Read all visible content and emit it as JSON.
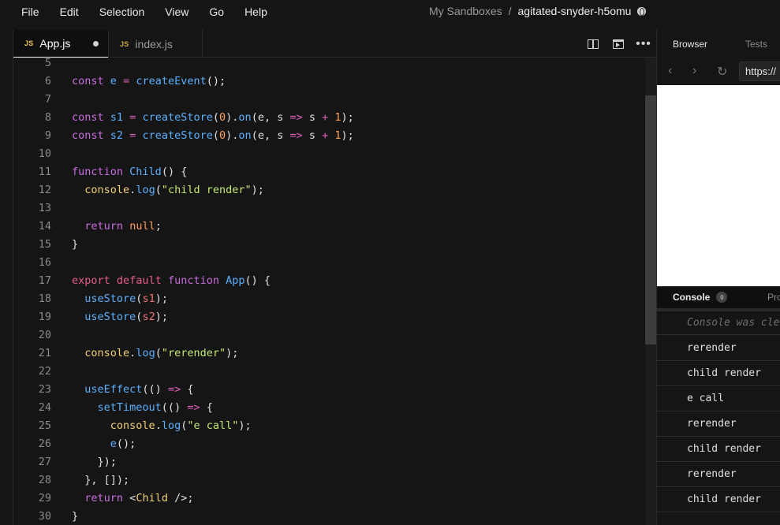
{
  "menubar": {
    "items": [
      "File",
      "Edit",
      "Selection",
      "View",
      "Go",
      "Help"
    ],
    "breadcrumb_parent": "My Sandboxes",
    "breadcrumb_separator": "/",
    "breadcrumb_current": "agitated-snyder-h5omu"
  },
  "editor": {
    "tabs": [
      {
        "badge": "JS",
        "label": "App.js",
        "active": true,
        "unsaved": true
      },
      {
        "badge": "JS",
        "label": "index.js",
        "active": false,
        "unsaved": false
      }
    ],
    "actions": [
      "split-view-icon",
      "open-preview-icon",
      "more-icon"
    ],
    "more_glyph": "•••",
    "lines": [
      {
        "n": "5",
        "tokens": []
      },
      {
        "n": "6",
        "tokens": [
          [
            "kw",
            "const"
          ],
          [
            "p",
            " "
          ],
          [
            "fn",
            "e"
          ],
          [
            "p",
            " "
          ],
          [
            "op",
            "="
          ],
          [
            "p",
            " "
          ],
          [
            "fn",
            "createEvent"
          ],
          [
            "p",
            "();"
          ]
        ]
      },
      {
        "n": "7",
        "tokens": []
      },
      {
        "n": "8",
        "tokens": [
          [
            "kw",
            "const"
          ],
          [
            "p",
            " "
          ],
          [
            "fn",
            "s1"
          ],
          [
            "p",
            " "
          ],
          [
            "op",
            "="
          ],
          [
            "p",
            " "
          ],
          [
            "fn",
            "createStore"
          ],
          [
            "p",
            "("
          ],
          [
            "num",
            "0"
          ],
          [
            "p",
            ")."
          ],
          [
            "fn",
            "on"
          ],
          [
            "p",
            "(e, s "
          ],
          [
            "op",
            "=>"
          ],
          [
            "p",
            " s "
          ],
          [
            "op",
            "+"
          ],
          [
            "p",
            " "
          ],
          [
            "num",
            "1"
          ],
          [
            "p",
            ");"
          ]
        ]
      },
      {
        "n": "9",
        "tokens": [
          [
            "kw",
            "const"
          ],
          [
            "p",
            " "
          ],
          [
            "fn",
            "s2"
          ],
          [
            "p",
            " "
          ],
          [
            "op",
            "="
          ],
          [
            "p",
            " "
          ],
          [
            "fn",
            "createStore"
          ],
          [
            "p",
            "("
          ],
          [
            "num",
            "0"
          ],
          [
            "p",
            ")."
          ],
          [
            "fn",
            "on"
          ],
          [
            "p",
            "(e, s "
          ],
          [
            "op",
            "=>"
          ],
          [
            "p",
            " s "
          ],
          [
            "op",
            "+"
          ],
          [
            "p",
            " "
          ],
          [
            "num",
            "1"
          ],
          [
            "p",
            ");"
          ]
        ]
      },
      {
        "n": "10",
        "tokens": []
      },
      {
        "n": "11",
        "tokens": [
          [
            "kw",
            "function"
          ],
          [
            "p",
            " "
          ],
          [
            "fn",
            "Child"
          ],
          [
            "p",
            "() {"
          ]
        ]
      },
      {
        "n": "12",
        "tokens": [
          [
            "p",
            "  "
          ],
          [
            "obj",
            "console"
          ],
          [
            "p",
            "."
          ],
          [
            "fn",
            "log"
          ],
          [
            "p",
            "("
          ],
          [
            "str",
            "\"child render\""
          ],
          [
            "p",
            ");"
          ]
        ]
      },
      {
        "n": "13",
        "tokens": []
      },
      {
        "n": "14",
        "tokens": [
          [
            "p",
            "  "
          ],
          [
            "kw",
            "return"
          ],
          [
            "p",
            " "
          ],
          [
            "num",
            "null"
          ],
          [
            "p",
            ";"
          ]
        ]
      },
      {
        "n": "15",
        "tokens": [
          [
            "p",
            "}"
          ]
        ]
      },
      {
        "n": "16",
        "tokens": []
      },
      {
        "n": "17",
        "tokens": [
          [
            "kw2",
            "export"
          ],
          [
            "p",
            " "
          ],
          [
            "kw2",
            "default"
          ],
          [
            "p",
            " "
          ],
          [
            "kw",
            "function"
          ],
          [
            "p",
            " "
          ],
          [
            "fn",
            "App"
          ],
          [
            "p",
            "() {"
          ]
        ]
      },
      {
        "n": "18",
        "tokens": [
          [
            "p",
            "  "
          ],
          [
            "fn",
            "useStore"
          ],
          [
            "p",
            "("
          ],
          [
            "var",
            "s1"
          ],
          [
            "p",
            ");"
          ]
        ]
      },
      {
        "n": "19",
        "tokens": [
          [
            "p",
            "  "
          ],
          [
            "fn",
            "useStore"
          ],
          [
            "p",
            "("
          ],
          [
            "var",
            "s2"
          ],
          [
            "p",
            ");"
          ]
        ]
      },
      {
        "n": "20",
        "tokens": []
      },
      {
        "n": "21",
        "tokens": [
          [
            "p",
            "  "
          ],
          [
            "obj",
            "console"
          ],
          [
            "p",
            "."
          ],
          [
            "fn",
            "log"
          ],
          [
            "p",
            "("
          ],
          [
            "str",
            "\"rerender\""
          ],
          [
            "p",
            ");"
          ]
        ]
      },
      {
        "n": "22",
        "tokens": []
      },
      {
        "n": "23",
        "tokens": [
          [
            "p",
            "  "
          ],
          [
            "fn",
            "useEffect"
          ],
          [
            "p",
            "(() "
          ],
          [
            "op",
            "=>"
          ],
          [
            "p",
            " {"
          ]
        ]
      },
      {
        "n": "24",
        "tokens": [
          [
            "p",
            "    "
          ],
          [
            "fn",
            "setTimeout"
          ],
          [
            "p",
            "(() "
          ],
          [
            "op",
            "=>"
          ],
          [
            "p",
            " {"
          ]
        ]
      },
      {
        "n": "25",
        "tokens": [
          [
            "p",
            "      "
          ],
          [
            "obj",
            "console"
          ],
          [
            "p",
            "."
          ],
          [
            "fn",
            "log"
          ],
          [
            "p",
            "("
          ],
          [
            "str",
            "\"e call\""
          ],
          [
            "p",
            ");"
          ]
        ]
      },
      {
        "n": "26",
        "tokens": [
          [
            "p",
            "      "
          ],
          [
            "fn",
            "e"
          ],
          [
            "p",
            "();"
          ]
        ]
      },
      {
        "n": "27",
        "tokens": [
          [
            "p",
            "    });"
          ]
        ]
      },
      {
        "n": "28",
        "tokens": [
          [
            "p",
            "  }, []);"
          ]
        ]
      },
      {
        "n": "29",
        "tokens": [
          [
            "p",
            "  "
          ],
          [
            "kw",
            "return"
          ],
          [
            "p",
            " <"
          ],
          [
            "jsx",
            "Child"
          ],
          [
            "p",
            " />;"
          ]
        ]
      },
      {
        "n": "30",
        "tokens": [
          [
            "p",
            "}"
          ]
        ]
      }
    ]
  },
  "right_panel": {
    "tabs": [
      "Browser",
      "Tests"
    ],
    "nav": {
      "back": "‹",
      "forward": "›",
      "reload": "↻"
    },
    "url": "https://",
    "console_tab": "Console",
    "console_count": "0",
    "problems_tab": "Pro",
    "console_logs": [
      {
        "text": "Console was cle",
        "cleared": true
      },
      {
        "text": "rerender",
        "cleared": false
      },
      {
        "text": "child render",
        "cleared": false
      },
      {
        "text": "e call",
        "cleared": false
      },
      {
        "text": "rerender",
        "cleared": false
      },
      {
        "text": "child render",
        "cleared": false
      },
      {
        "text": "rerender",
        "cleared": false
      },
      {
        "text": "child render",
        "cleared": false
      }
    ]
  },
  "colors": {
    "background": "#151515",
    "keyword": "#c96de0",
    "export_keyword": "#e65c8a",
    "function": "#5ab1ff",
    "number": "#ff9f57",
    "string": "#c4e86d",
    "object": "#f1d06f"
  }
}
